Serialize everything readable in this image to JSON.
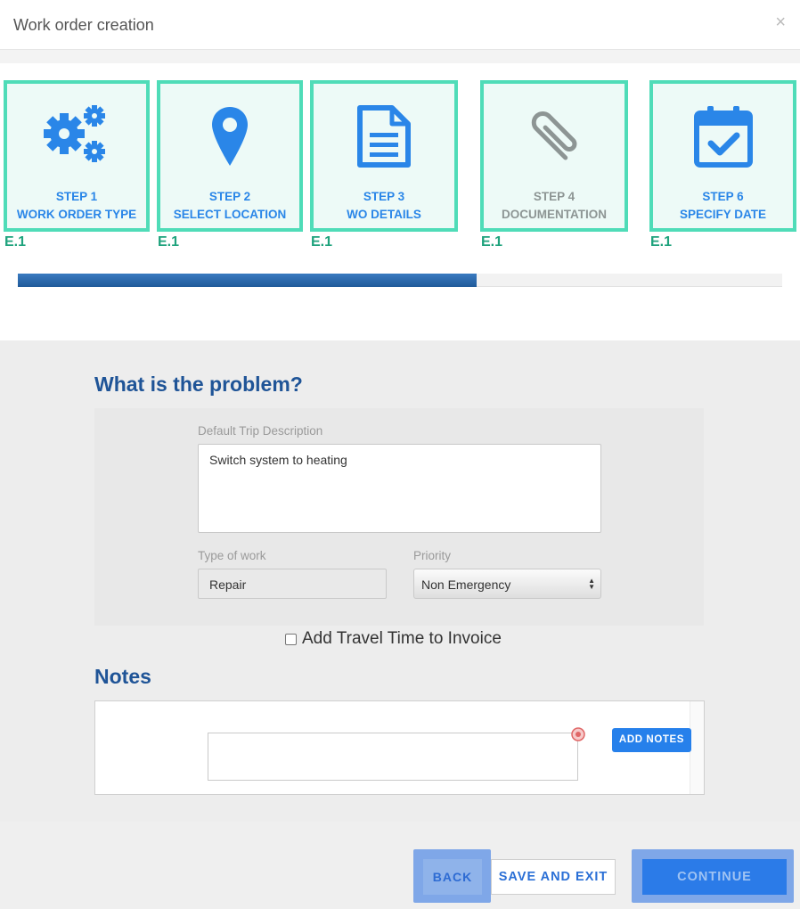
{
  "window": {
    "title": "Work order creation",
    "close_glyph": "×"
  },
  "steps": [
    {
      "number": "STEP 1",
      "name": "WORK ORDER TYPE",
      "code": "E.1",
      "icon": "gears-icon",
      "state": "active"
    },
    {
      "number": "STEP 2",
      "name": "SELECT LOCATION",
      "code": "E.1",
      "icon": "map-pin-icon",
      "state": "active"
    },
    {
      "number": "STEP 3",
      "name": "WO DETAILS",
      "code": "E.1",
      "icon": "document-icon",
      "state": "active"
    },
    {
      "number": "STEP 4",
      "name": "DOCUMENTATION",
      "code": "E.1",
      "icon": "paperclip-icon",
      "state": "disabled"
    },
    {
      "number": "STEP 6",
      "name": "SPECIFY DATE",
      "code": "E.1",
      "icon": "calendar-check-icon",
      "state": "active"
    }
  ],
  "progress": {
    "percent": 60
  },
  "problem": {
    "title": "What is the problem?",
    "description_label": "Default Trip Description",
    "description_value": "Switch system to heating",
    "type_label": "Type of work",
    "type_value": "Repair",
    "priority_label": "Priority",
    "priority_value": "Non Emergency",
    "travel_label": "Add Travel Time to Invoice",
    "travel_checked": false
  },
  "notes": {
    "title": "Notes",
    "input_value": "",
    "add_button": "ADD NOTES"
  },
  "footer": {
    "back": "BACK",
    "save_exit": "SAVE AND EXIT",
    "continue": "CONTINUE"
  },
  "colors": {
    "accent": "#2a86e8",
    "step_border": "#4fdcb8",
    "step_code": "#1fa37d",
    "heading": "#1f5497",
    "disabled": "#8d9594"
  }
}
